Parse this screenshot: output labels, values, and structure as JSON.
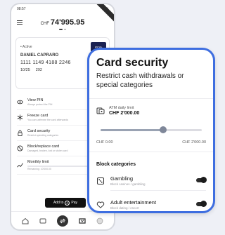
{
  "status_bar": {
    "time": "08:57"
  },
  "header": {
    "currency": "CHF",
    "balance": "74'995.95"
  },
  "card": {
    "state": "• Active",
    "holder": "DANIEL CAPRARO",
    "number": "1111 1149 4188 2246",
    "expiry": "10/25",
    "cvv": "292",
    "logo_text": "ENTIAL"
  },
  "menu": [
    {
      "title": "View PIN",
      "subtitle": "Always protect the PIN"
    },
    {
      "title": "Freeze card",
      "subtitle": "You can unfreeze the card afterwards"
    },
    {
      "title": "Card security",
      "subtitle": "Restrict spending categories"
    },
    {
      "title": "Block/replace card",
      "subtitle": "Damaged, broken, lost or stolen card"
    },
    {
      "title": "Monthly limit",
      "subtitle": "Remaining: 10'000.00",
      "extra": "Max: 1..."
    }
  ],
  "pay_button": {
    "label": "Add to",
    "brand": "Pay",
    "glyph": "G"
  },
  "panel": {
    "title": "Card security",
    "subtitle": "Restrict cash withdrawals or special categories",
    "atm": {
      "label": "ATM daily limit",
      "value": "CHF 2'000.00",
      "fraction": 0.62
    },
    "range": {
      "min": "CHF 0.00",
      "max": "CHF 2'000.00"
    },
    "block_heading": "Block categories",
    "categories": [
      {
        "title": "Gambling",
        "subtitle": "Block casinos / gambling",
        "enabled": true
      },
      {
        "title": "Adult entertainment",
        "subtitle": "Block dating / escort",
        "enabled": true
      }
    ]
  },
  "icons": {
    "menu": "hamburger-icon",
    "pin": "eye-icon",
    "freeze": "snowflake-icon",
    "security": "lock-icon",
    "block": "ban-icon",
    "limit": "trend-icon",
    "atm": "cash-icon",
    "gambling": "dice-icon",
    "adult": "heart-icon"
  },
  "colors": {
    "accent": "#3e6ee0",
    "card_logo": "#1b2252"
  }
}
